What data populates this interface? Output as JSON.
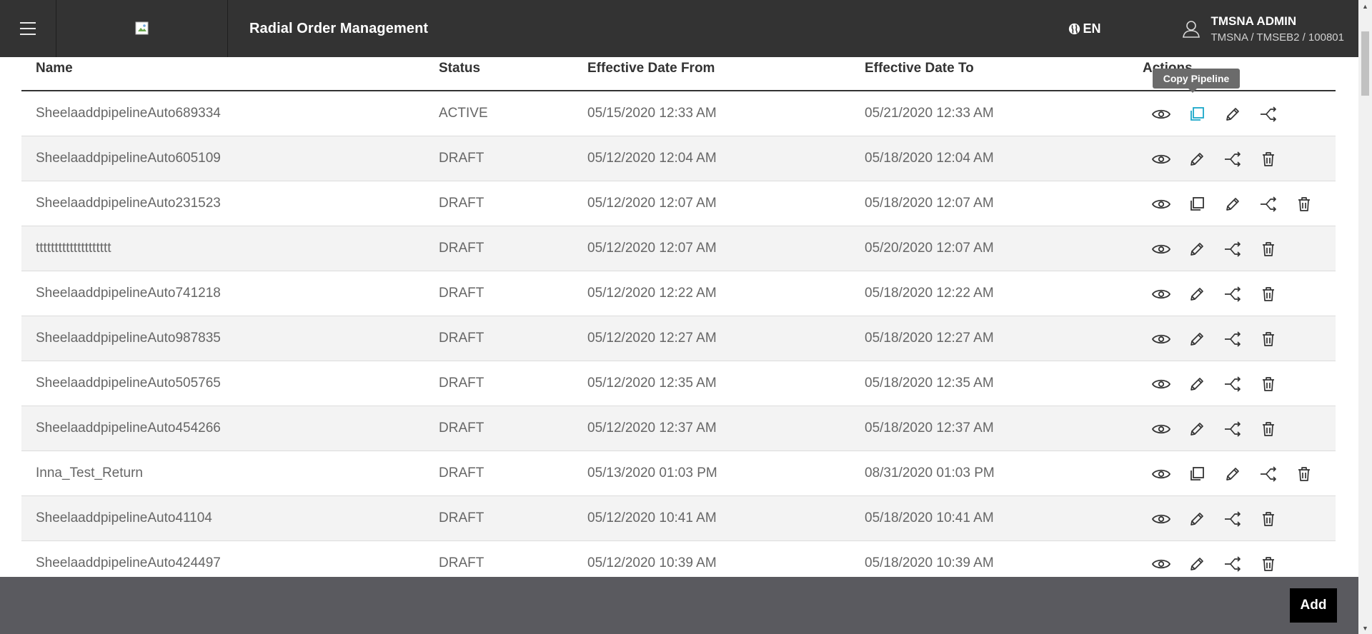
{
  "header": {
    "app_title": "Radial Order Management",
    "language": "EN",
    "user_name": "TMSNA ADMIN",
    "user_org": "TMSNA / TMSEB2 / 100801"
  },
  "table": {
    "columns": [
      "Name",
      "Status",
      "Effective Date From",
      "Effective Date To",
      "Actions"
    ],
    "rows": [
      {
        "name": "SheelaaddpipelineAuto689334",
        "status": "ACTIVE",
        "from": "05/15/2020 12:33 AM",
        "to": "05/21/2020 12:33 AM"
      },
      {
        "name": "SheelaaddpipelineAuto605109",
        "status": "DRAFT",
        "from": "05/12/2020 12:04 AM",
        "to": "05/18/2020 12:04 AM"
      },
      {
        "name": "SheelaaddpipelineAuto231523",
        "status": "DRAFT",
        "from": "05/12/2020 12:07 AM",
        "to": "05/18/2020 12:07 AM"
      },
      {
        "name": "tttttttttttttttttttt",
        "status": "DRAFT",
        "from": "05/12/2020 12:07 AM",
        "to": "05/20/2020 12:07 AM"
      },
      {
        "name": "SheelaaddpipelineAuto741218",
        "status": "DRAFT",
        "from": "05/12/2020 12:22 AM",
        "to": "05/18/2020 12:22 AM"
      },
      {
        "name": "SheelaaddpipelineAuto987835",
        "status": "DRAFT",
        "from": "05/12/2020 12:27 AM",
        "to": "05/18/2020 12:27 AM"
      },
      {
        "name": "SheelaaddpipelineAuto505765",
        "status": "DRAFT",
        "from": "05/12/2020 12:35 AM",
        "to": "05/18/2020 12:35 AM"
      },
      {
        "name": "SheelaaddpipelineAuto454266",
        "status": "DRAFT",
        "from": "05/12/2020 12:37 AM",
        "to": "05/18/2020 12:37 AM"
      },
      {
        "name": "Inna_Test_Return",
        "status": "DRAFT",
        "from": "05/13/2020 01:03 PM",
        "to": "08/31/2020 01:03 PM"
      },
      {
        "name": "SheelaaddpipelineAuto41104",
        "status": "DRAFT",
        "from": "05/12/2020 10:41 AM",
        "to": "05/18/2020 10:41 AM"
      },
      {
        "name": "SheelaaddpipelineAuto424497",
        "status": "DRAFT",
        "from": "05/12/2020 10:39 AM",
        "to": "05/18/2020 10:39 AM"
      }
    ]
  },
  "tooltip": {
    "text": "Copy Pipeline"
  },
  "footer": {
    "add_label": "Add"
  },
  "colors": {
    "topbar": "#333333",
    "footer": "#5a5a5f",
    "accent_copy": "#1aa7c9",
    "zebra": "#f3f3f3"
  }
}
